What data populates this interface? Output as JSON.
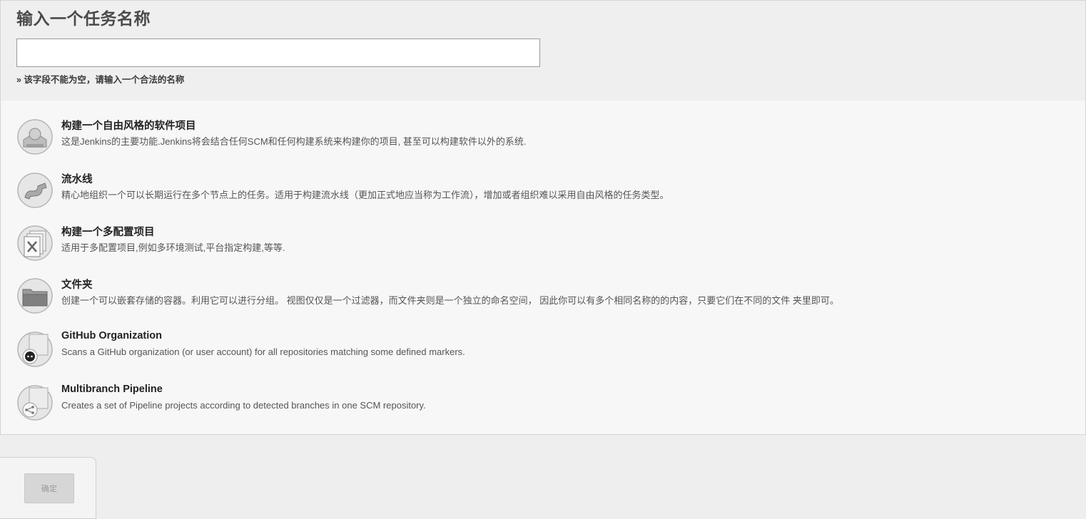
{
  "header": {
    "title": "输入一个任务名称",
    "name_input": {
      "value": "",
      "placeholder": ""
    },
    "validation_message": "» 该字段不能为空，请输入一个合法的名称"
  },
  "items": [
    {
      "title": "构建一个自由风格的软件项目",
      "description": "这是Jenkins的主要功能.Jenkins将会结合任何SCM和任何构建系统来构建你的项目, 甚至可以构建软件以外的系统.",
      "icon": "freestyle-project-icon"
    },
    {
      "title": "流水线",
      "description": "精心地组织一个可以长期运行在多个节点上的任务。适用于构建流水线（更加正式地应当称为工作流），增加或者组织难以采用自由风格的任务类型。",
      "icon": "pipeline-icon"
    },
    {
      "title": "构建一个多配置项目",
      "description": "适用于多配置项目,例如多环境测试,平台指定构建,等等.",
      "icon": "multi-config-icon"
    },
    {
      "title": "文件夹",
      "description": "创建一个可以嵌套存储的容器。利用它可以进行分组。 视图仅仅是一个过滤器，而文件夹则是一个独立的命名空间， 因此你可以有多个相同名称的的内容，只要它们在不同的文件 夹里即可。",
      "icon": "folder-icon"
    },
    {
      "title": "GitHub Organization",
      "description": "Scans a GitHub organization (or user account) for all repositories matching some defined markers.",
      "icon": "github-organization-icon"
    },
    {
      "title": "Multibranch Pipeline",
      "description": "Creates a set of Pipeline projects according to detected branches in one SCM repository.",
      "icon": "multibranch-pipeline-icon"
    }
  ],
  "footer": {
    "ok_label": "确定"
  }
}
